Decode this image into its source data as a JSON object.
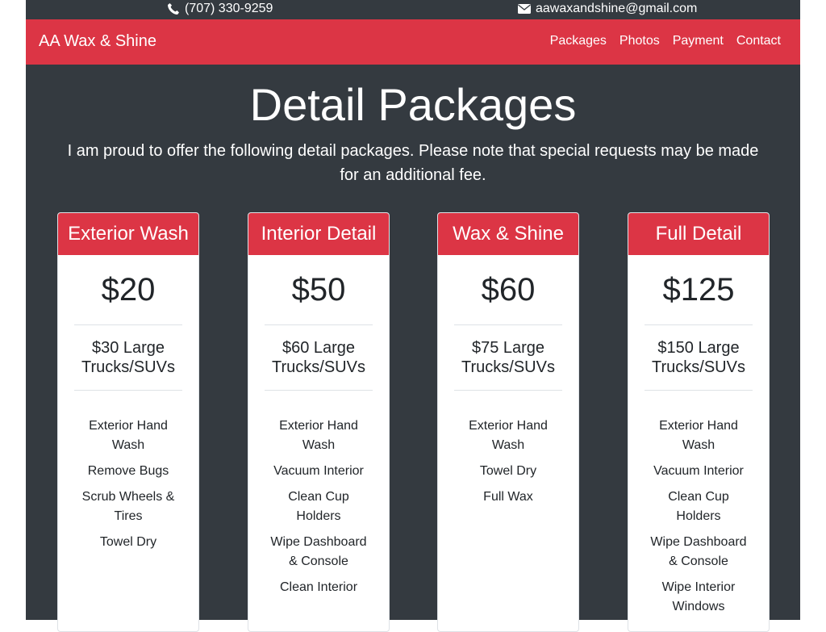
{
  "topbar": {
    "phone": "(707) 330-9259",
    "email": "aawaxandshine@gmail.com"
  },
  "nav": {
    "brand": "AA Wax & Shine",
    "links": [
      "Packages",
      "Photos",
      "Payment",
      "Contact"
    ]
  },
  "main": {
    "title": "Detail Packages",
    "intro": "I am proud to offer the following detail packages. Please note that special requests may be made for an additional fee."
  },
  "packages": [
    {
      "name": "Exterior Wash",
      "price": "$20",
      "large": "$30 Large Trucks/SUVs",
      "features": [
        "Exterior Hand Wash",
        "Remove Bugs",
        "Scrub Wheels & Tires",
        "Towel Dry"
      ]
    },
    {
      "name": "Interior Detail",
      "price": "$50",
      "large": "$60 Large Trucks/SUVs",
      "features": [
        "Exterior Hand Wash",
        "Vacuum Interior",
        "Clean Cup Holders",
        "Wipe Dashboard & Console",
        "Clean Interior"
      ]
    },
    {
      "name": "Wax & Shine",
      "price": "$60",
      "large": "$75 Large Trucks/SUVs",
      "features": [
        "Exterior Hand Wash",
        "Towel Dry",
        "Full Wax"
      ]
    },
    {
      "name": "Full Detail",
      "price": "$125",
      "large": "$150 Large Trucks/SUVs",
      "features": [
        "Exterior Hand Wash",
        "Vacuum Interior",
        "Clean Cup Holders",
        "Wipe Dashboard & Console",
        "Wipe Interior Windows"
      ]
    }
  ],
  "colors": {
    "accent": "#dc3545",
    "dark": "#343a40"
  }
}
